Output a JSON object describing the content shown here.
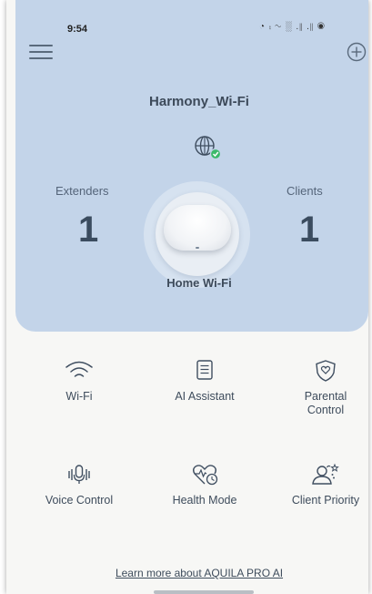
{
  "status_bar": {
    "time": "9:54",
    "icons": "◔ ⨾ ∿ ░ .∥ .∥ ◉"
  },
  "header": {
    "menu_icon": "hamburger-icon",
    "add_icon": "plus-circle-icon"
  },
  "network": {
    "name": "Harmony_Wi-Fi",
    "internet_status_icon": "globe-check-icon",
    "status_color": "#3cb96b"
  },
  "stats": {
    "extenders_label": "Extenders",
    "extenders_value": "1",
    "clients_label": "Clients",
    "clients_value": "1"
  },
  "router": {
    "label": "Home Wi-Fi"
  },
  "features": [
    {
      "label": "Wi-Fi",
      "icon": "wifi-icon"
    },
    {
      "label": "AI Assistant",
      "icon": "document-icon"
    },
    {
      "label": "Parental\nControl",
      "icon": "shield-heart-icon"
    },
    {
      "label": "Voice Control",
      "icon": "microphone-icon"
    },
    {
      "label": "Health Mode",
      "icon": "heart-clock-icon"
    },
    {
      "label": "Client Priority",
      "icon": "users-star-icon"
    }
  ],
  "footer": {
    "learn_more": "Learn more about AQUILA PRO AI"
  },
  "colors": {
    "hero_bg": "#c3d4e9",
    "page_bg": "#f7f7f5",
    "text_dark": "#3b4c5f"
  }
}
